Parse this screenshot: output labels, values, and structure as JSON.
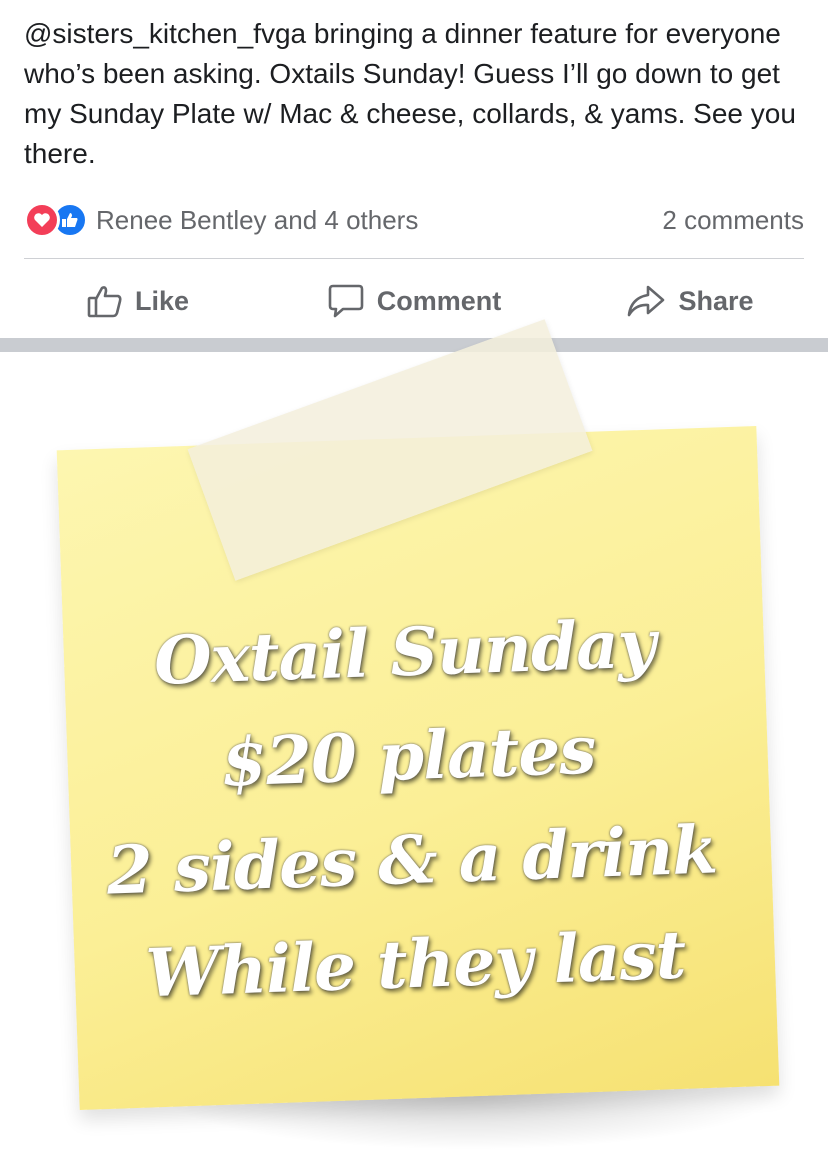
{
  "post": {
    "text": "@sisters_kitchen_fvga bringing a dinner feature for everyone who’s been asking. Oxtails Sunday! Guess I’ll go down to get my Sunday Plate w/ Mac & cheese, collards, & yams. See you there."
  },
  "reactions": {
    "icons": [
      "heart-icon",
      "like-icon"
    ],
    "summary": "Renee Bentley and 4 others",
    "comments": "2 comments"
  },
  "actions": {
    "like": "Like",
    "comment": "Comment",
    "share": "Share"
  },
  "image": {
    "lines": [
      "Oxtail Sunday",
      "$20 plates",
      "2 sides & a drink",
      "While they last"
    ]
  },
  "colors": {
    "text_secondary": "#65676b",
    "love": "#f33e58",
    "like": "#1877f2",
    "note_yellow": "#fbef96"
  }
}
